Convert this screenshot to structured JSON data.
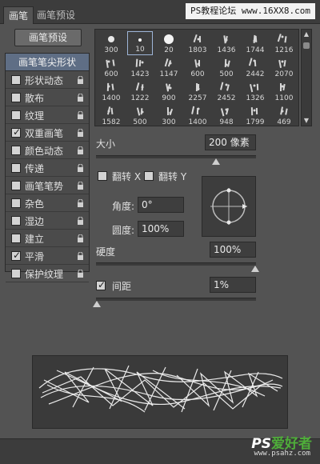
{
  "tabs": [
    {
      "label": "画笔",
      "active": true
    },
    {
      "label": "画笔预设",
      "active": false
    }
  ],
  "watermark_top": "PS教程论坛 www.16XX8.com",
  "preset_button": "画笔预设",
  "sidebar": {
    "header": "画笔笔尖形状",
    "items": [
      {
        "label": "形状动态",
        "checked": false
      },
      {
        "label": "散布",
        "checked": false
      },
      {
        "label": "纹理",
        "checked": false
      },
      {
        "label": "双重画笔",
        "checked": true
      },
      {
        "label": "颜色动态",
        "checked": false
      },
      {
        "label": "传递",
        "checked": false
      },
      {
        "label": "画笔笔势",
        "checked": false
      },
      {
        "label": "杂色",
        "checked": false
      },
      {
        "label": "湿边",
        "checked": false
      },
      {
        "label": "建立",
        "checked": false
      },
      {
        "label": "平滑",
        "checked": true
      },
      {
        "label": "保护纹理",
        "checked": false
      }
    ]
  },
  "brushes": {
    "rows": [
      [
        "300",
        "10",
        "20",
        "1803",
        "1436",
        "1744",
        "1216"
      ],
      [
        "600",
        "1423",
        "1147",
        "600",
        "500",
        "2442",
        "2070"
      ],
      [
        "1400",
        "1222",
        "900",
        "2257",
        "2452",
        "1326",
        "1100"
      ],
      [
        "1582",
        "500",
        "300",
        "1400",
        "948",
        "1799",
        "469"
      ]
    ],
    "selected_size": "10"
  },
  "size": {
    "label": "大小",
    "value": "200 像素"
  },
  "flip_x": {
    "label": "翻转 X",
    "checked": false
  },
  "flip_y": {
    "label": "翻转 Y",
    "checked": false
  },
  "angle": {
    "label": "角度:",
    "value": "0°"
  },
  "roundness": {
    "label": "圆度:",
    "value": "100%"
  },
  "hardness": {
    "label": "硬度",
    "value": "100%"
  },
  "spacing": {
    "label": "间距",
    "value": "1%",
    "checked": true
  },
  "bottom_logo": {
    "ps": "PS",
    "text": "爱好者"
  },
  "bottom_url": "www.psahz.com"
}
